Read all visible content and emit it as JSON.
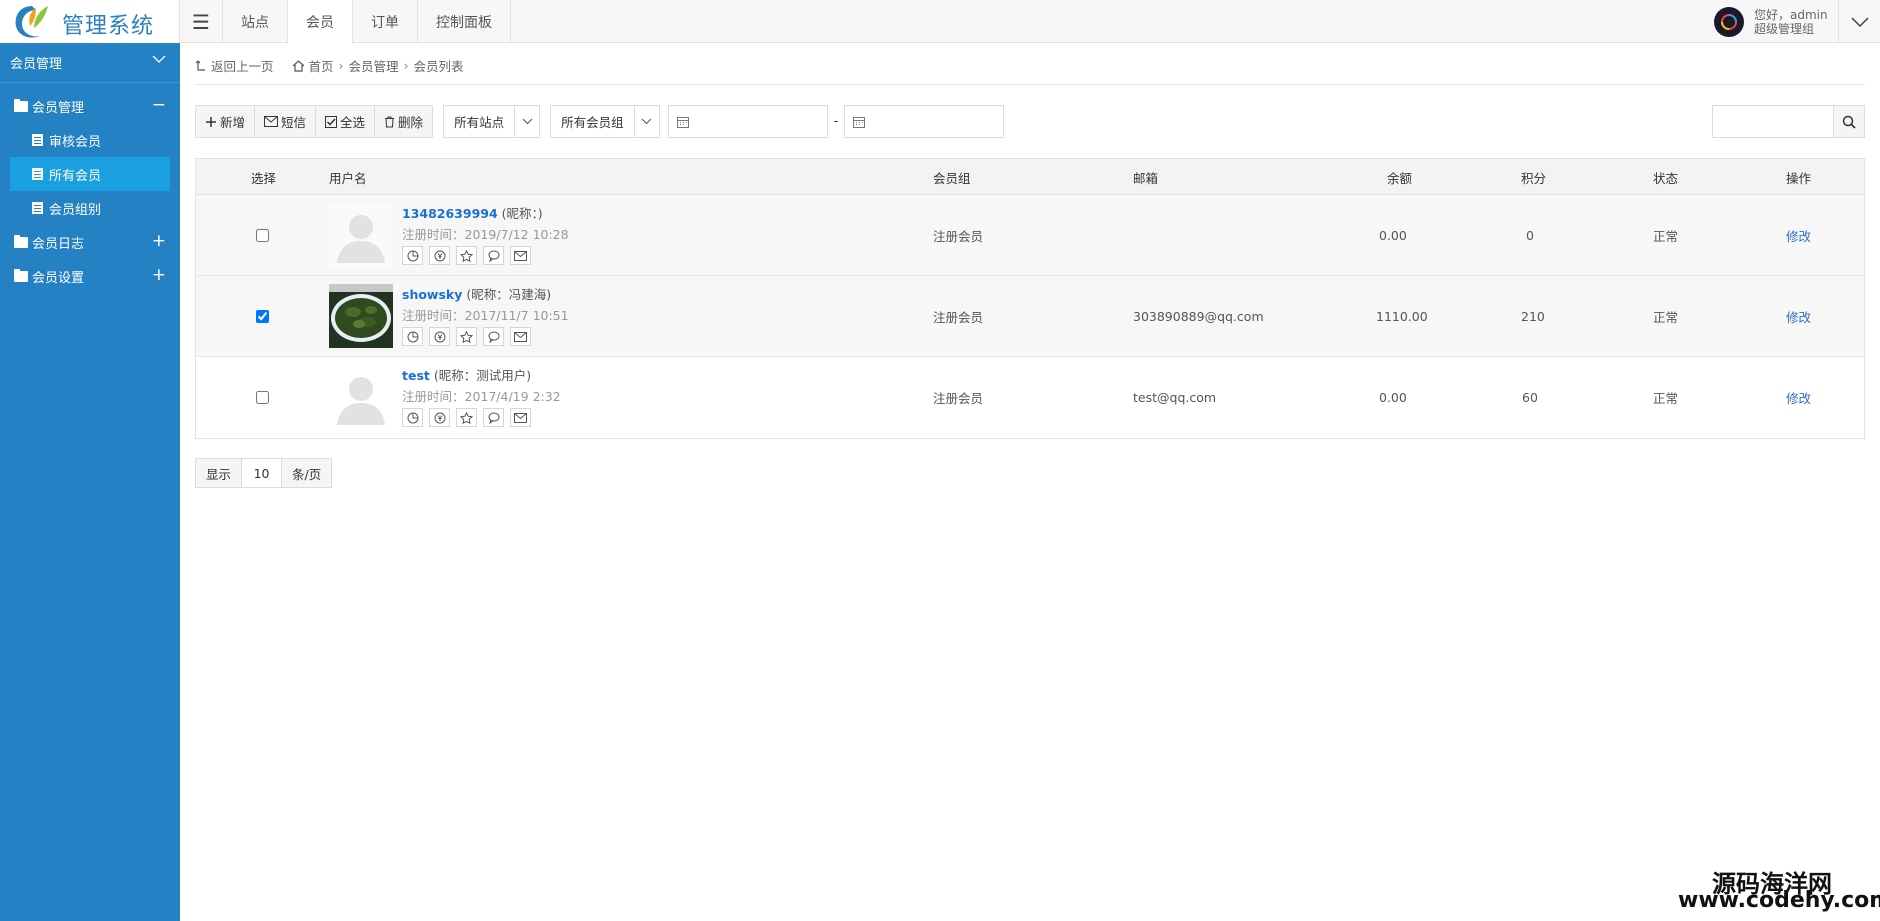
{
  "app": {
    "title": "管理系统"
  },
  "nav": {
    "items": [
      "站点",
      "会员",
      "订单",
      "控制面板"
    ],
    "active": "会员"
  },
  "user": {
    "greeting": "您好，admin",
    "role": "超级管理组"
  },
  "sidebar": {
    "header": "会员管理",
    "groups": [
      {
        "label": "会员管理",
        "toggle": "−",
        "items": [
          {
            "label": "审核会员"
          },
          {
            "label": "所有会员",
            "active": true
          },
          {
            "label": "会员组别"
          }
        ]
      },
      {
        "label": "会员日志",
        "toggle": "+"
      },
      {
        "label": "会员设置",
        "toggle": "+"
      }
    ]
  },
  "breadcrumb": {
    "back": "返回上一页",
    "home": "首页",
    "section": "会员管理",
    "current": "会员列表"
  },
  "toolbar": {
    "add": "新增",
    "sms": "短信",
    "select_all": "全选",
    "delete": "删除",
    "site_filter": "所有站点",
    "group_filter": "所有会员组",
    "date_sep": "-"
  },
  "table": {
    "headers": {
      "select": "选择",
      "username": "用户名",
      "group": "会员组",
      "email": "邮箱",
      "balance": "余额",
      "points": "积分",
      "status": "状态",
      "action": "操作"
    },
    "rows": [
      {
        "username": "13482639994",
        "nick": "(昵称：)",
        "reg": "注册时间：2019/7/12 10:28",
        "group": "注册会员",
        "email": "",
        "balance": "0.00",
        "points": "0",
        "status": "正常",
        "action": "修改",
        "checked": false
      },
      {
        "username": "showsky",
        "nick": "(昵称：冯建海)",
        "reg": "注册时间：2017/11/7 10:51",
        "group": "注册会员",
        "email": "303890889@qq.com",
        "balance": "1110.00",
        "points": "210",
        "status": "正常",
        "action": "修改",
        "checked": true
      },
      {
        "username": "test",
        "nick": "(昵称：测试用户)",
        "reg": "注册时间：2017/4/19 2:32",
        "group": "注册会员",
        "email": "test@qq.com",
        "balance": "0.00",
        "points": "60",
        "status": "正常",
        "action": "修改",
        "checked": false
      }
    ]
  },
  "pager": {
    "show": "显示",
    "per_page": "10",
    "unit": "条/页"
  },
  "watermark": {
    "line1": "源码海洋网",
    "line2": "www.codehy.com"
  },
  "colors": {
    "sidebar": "#2481c3",
    "sidebar_active": "#1aa0e0",
    "link": "#1a6fd4"
  }
}
